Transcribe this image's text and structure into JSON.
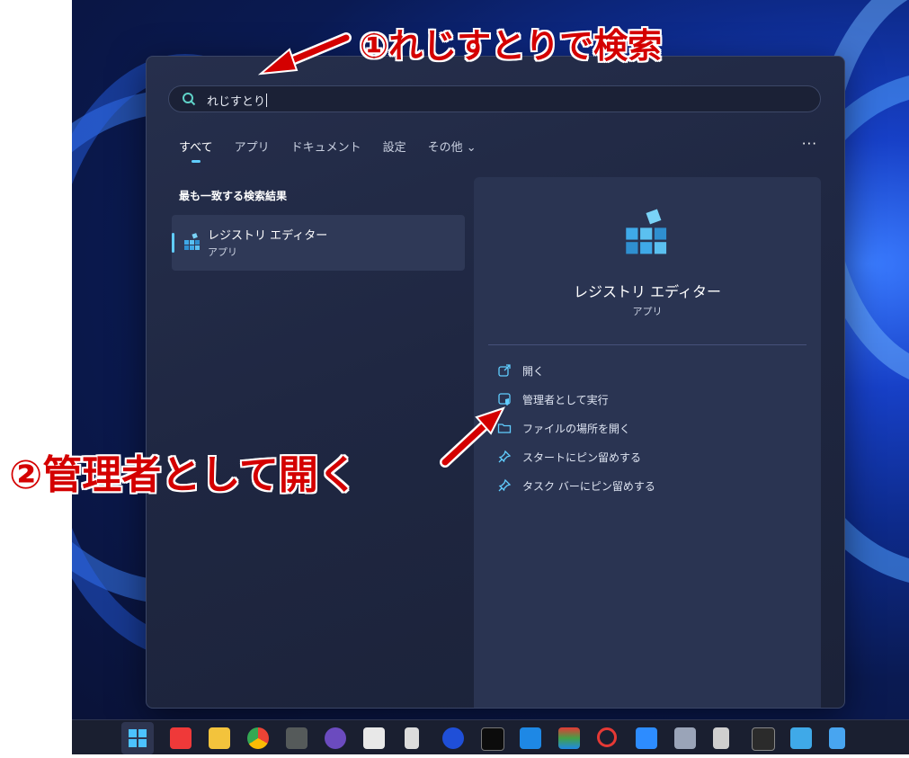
{
  "search": {
    "query": "れじすとり"
  },
  "tabs": [
    {
      "label": "すべて",
      "active": true
    },
    {
      "label": "アプリ"
    },
    {
      "label": "ドキュメント"
    },
    {
      "label": "設定"
    },
    {
      "label": "その他 ⌄"
    }
  ],
  "more_label": "···",
  "best_match": {
    "heading": "最も一致する検索結果",
    "name": "レジストリ エディター",
    "type": "アプリ"
  },
  "detail": {
    "name": "レジストリ エディター",
    "type": "アプリ",
    "actions": [
      {
        "label": "開く",
        "icon": "open-external-icon"
      },
      {
        "label": "管理者として実行",
        "icon": "admin-shield-icon"
      },
      {
        "label": "ファイルの場所を開く",
        "icon": "folder-icon"
      },
      {
        "label": "スタートにピン留めする",
        "icon": "pin-icon"
      },
      {
        "label": "タスク バーにピン留めする",
        "icon": "pin-icon"
      }
    ]
  },
  "annotations": {
    "step1": "①れじすとりで検索",
    "step2": "②管理者として開く"
  },
  "taskbar": {
    "icons": [
      "start-icon",
      "vivaldi-icon",
      "file-explorer-icon",
      "chrome-icon",
      "gimp-icon",
      "app-icon",
      "app-icon",
      "device-icon",
      "app-icon",
      "terminal-icon",
      "vscode-icon",
      "layers-icon",
      "search-app-icon",
      "zoom-icon",
      "app-icon",
      "app-icon",
      "terminal-icon",
      "registry-icon",
      "notepad-icon"
    ]
  },
  "colors": {
    "accent": "#60cdff",
    "annotation": "#d40000"
  }
}
